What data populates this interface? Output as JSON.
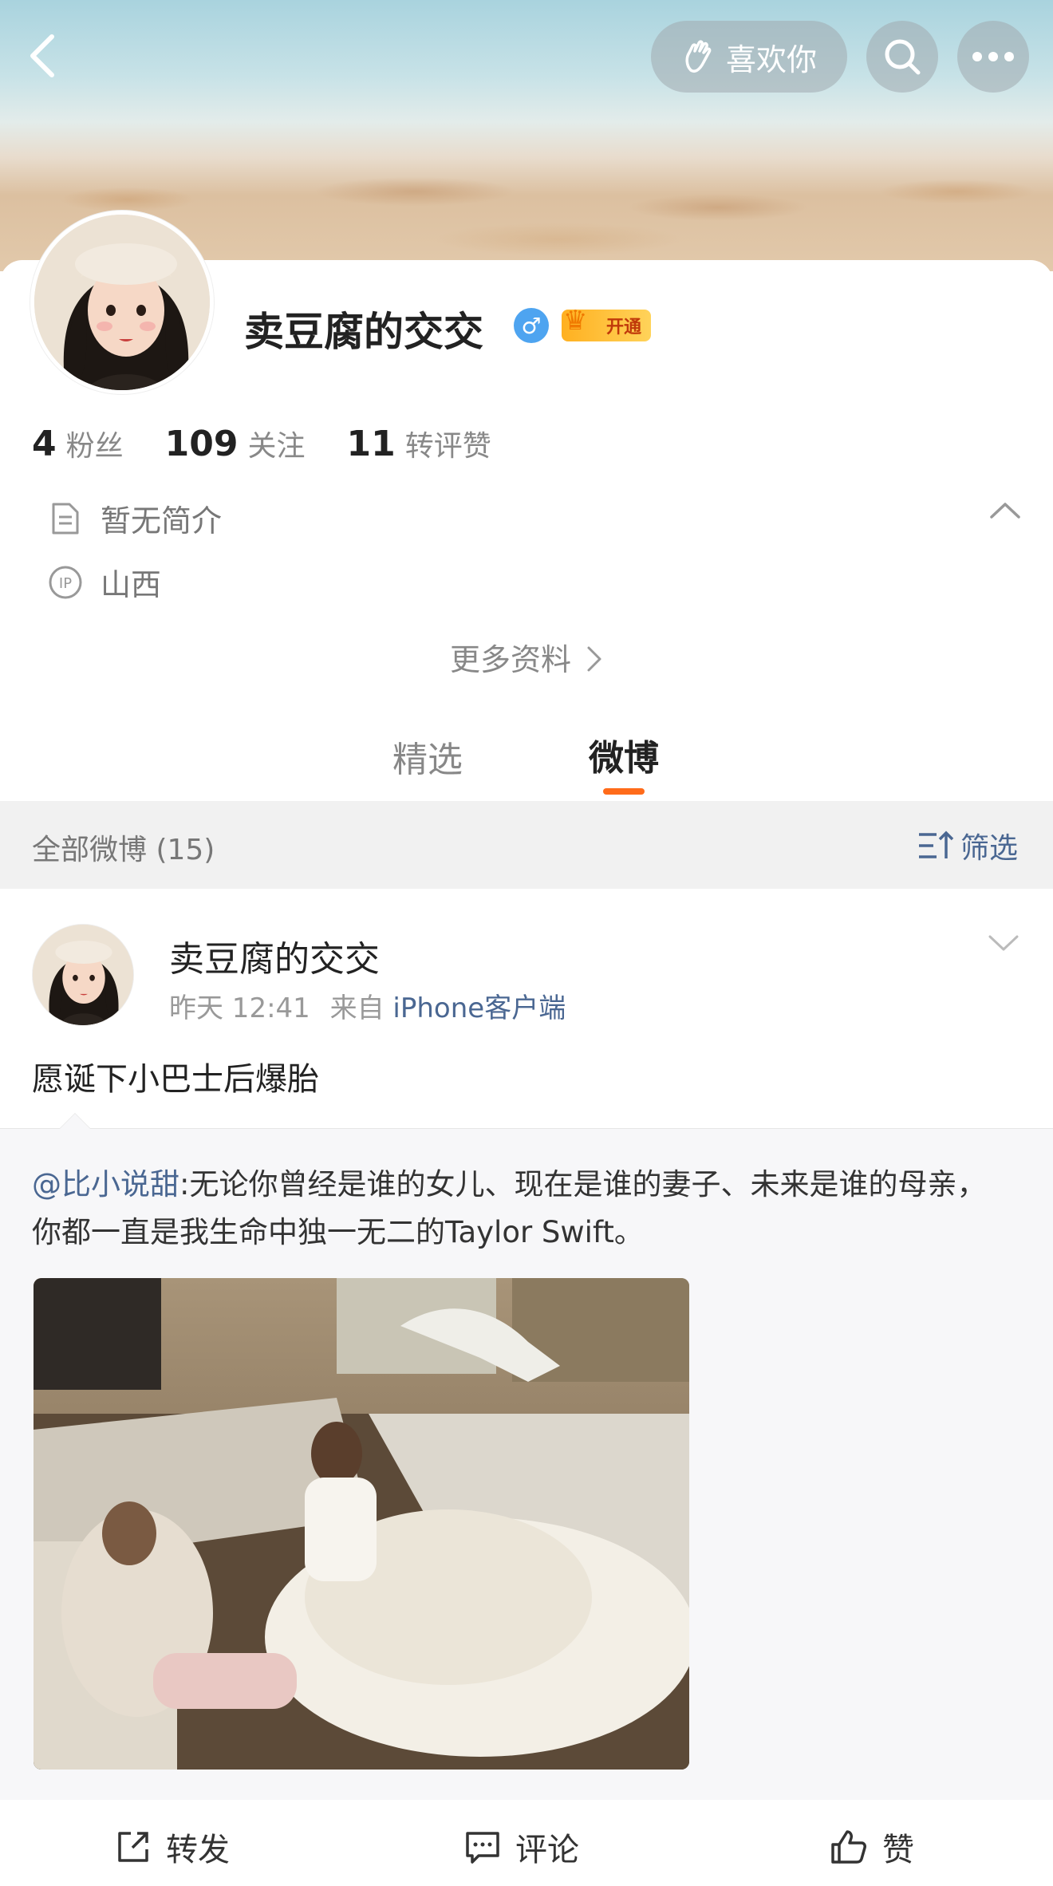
{
  "header": {
    "back_icon": "chevron-left-icon",
    "like_label": "喜欢你",
    "like_icon": "hand-wave-icon",
    "search_icon": "search-icon",
    "more_icon": "more-dots-icon"
  },
  "profile": {
    "nickname": "卖豆腐的交交",
    "gender_icon": "male-icon",
    "vip_label": "开通",
    "stats": [
      {
        "num": "4",
        "label": "粉丝"
      },
      {
        "num": "109",
        "label": "关注"
      },
      {
        "num": "11",
        "label": "转评赞"
      }
    ],
    "bio": "暂无简介",
    "ip_location": "山西",
    "more_info": "更多资料"
  },
  "tabs": [
    {
      "label": "精选",
      "active": false
    },
    {
      "label": "微博",
      "active": true
    }
  ],
  "filter": {
    "all_label": "全部微博 (15)",
    "filter_label": "筛选"
  },
  "post": {
    "author": "卖豆腐的交交",
    "time": "昨天 12:41",
    "from_prefix": "来自",
    "source": "iPhone客户端",
    "text": "愿诞下小巴士后爆胎",
    "repost": {
      "mention": "@比小说甜",
      "text_line1": ":无论你曾经是谁的女儿、现在是谁的妻子、未来是谁的母亲，",
      "text_line2": "你都一直是我生命中独一无二的Taylor Swift。"
    }
  },
  "actions": {
    "repost": "转发",
    "comment": "评论",
    "like": "赞"
  },
  "colors": {
    "accent_orange": "#ff6b1a",
    "link_blue": "#4a6792",
    "verified_blue": "#4ea4f0"
  }
}
